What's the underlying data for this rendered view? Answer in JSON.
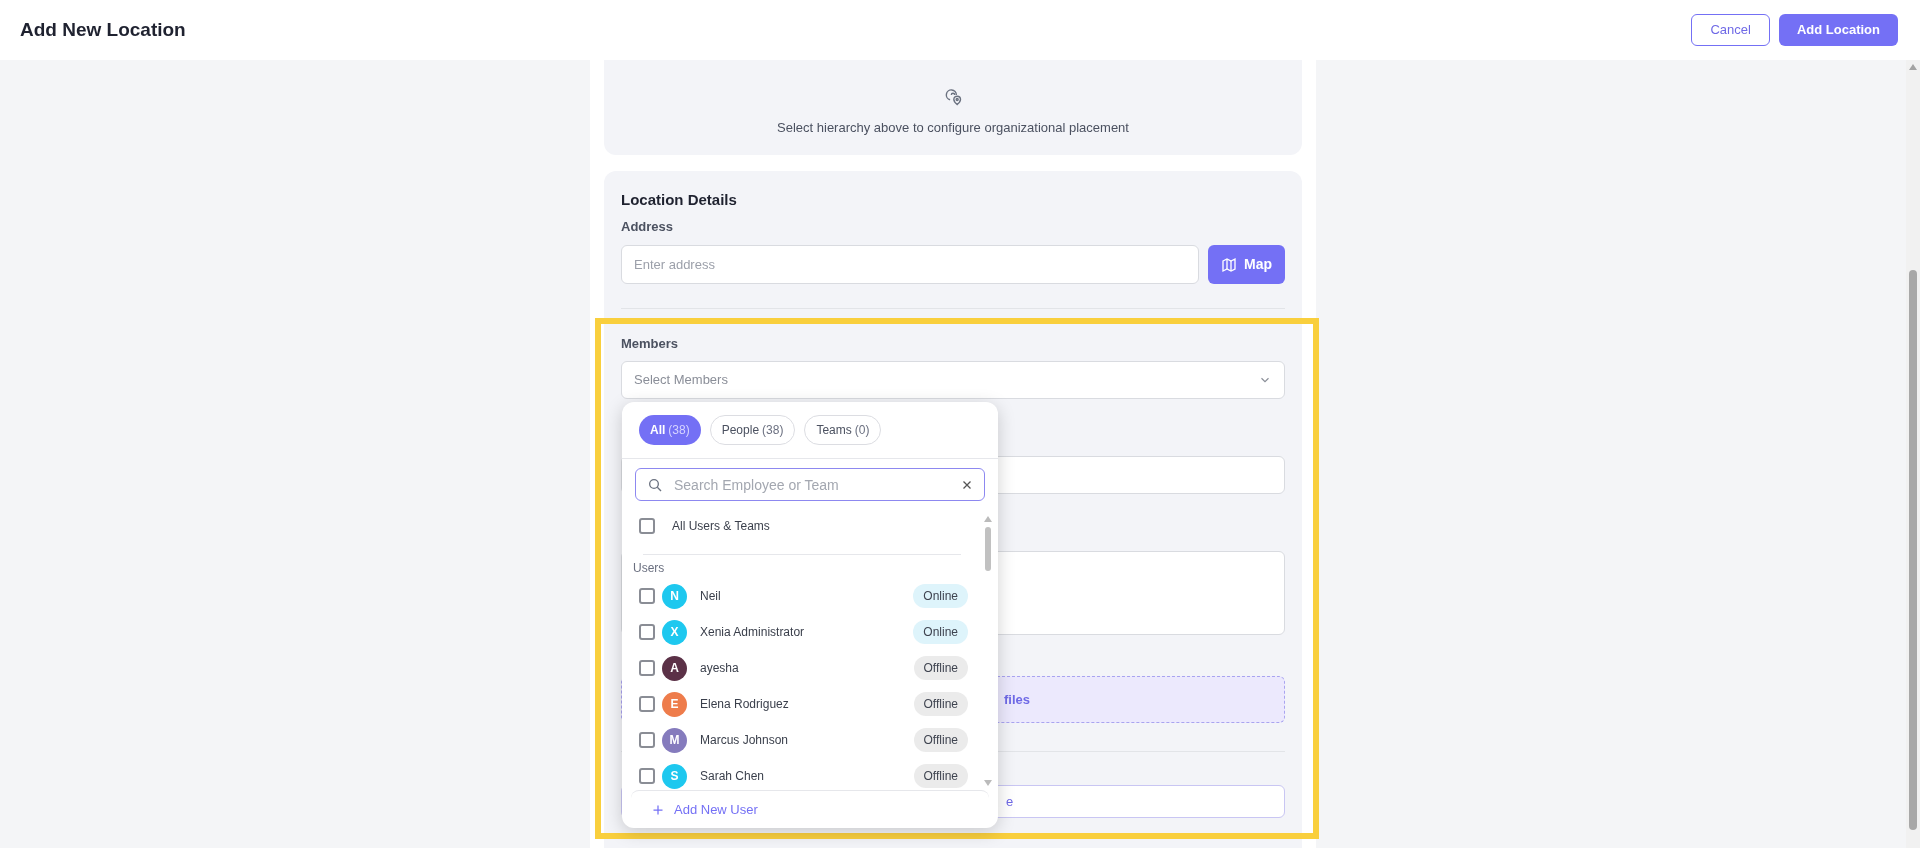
{
  "header": {
    "title": "Add New Location",
    "buttons": [
      {
        "label": "Cancel",
        "kind": "outline"
      },
      {
        "label": "Add Location",
        "kind": "primary"
      }
    ]
  },
  "placement_card": {
    "message": "Select hierarchy above to configure organizational placement"
  },
  "location_details": {
    "title": "Location Details",
    "address": {
      "label": "Address",
      "placeholder": "Enter address"
    },
    "map_button": "Map",
    "members": {
      "label": "Members",
      "placeholder": "Select Members"
    },
    "upload_text_fragment": "files",
    "field_text_fragment": "e"
  },
  "members_dropdown": {
    "tabs": [
      {
        "label": "All",
        "count": "(38)",
        "selected": true
      },
      {
        "label": "People",
        "count": "(38)",
        "selected": false
      },
      {
        "label": "Teams",
        "count": "(0)",
        "selected": false
      }
    ],
    "search": {
      "placeholder": "Search Employee or Team"
    },
    "select_all": {
      "label": "All Users & Teams",
      "checked": false
    },
    "section_label": "Users",
    "users": [
      {
        "initial": "N",
        "name": "Neil",
        "color": "#1ec8ef",
        "status": "Online",
        "online": true,
        "checked": false
      },
      {
        "initial": "X",
        "name": "Xenia Administrator",
        "color": "#1ec8ef",
        "status": "Online",
        "online": true,
        "checked": false
      },
      {
        "initial": "A",
        "name": "ayesha",
        "color": "#5b3147",
        "status": "Offline",
        "online": false,
        "checked": false
      },
      {
        "initial": "E",
        "name": "Elena Rodriguez",
        "color": "#ee7c4b",
        "status": "Offline",
        "online": false,
        "checked": false
      },
      {
        "initial": "M",
        "name": "Marcus Johnson",
        "color": "#857bbd",
        "status": "Offline",
        "online": false,
        "checked": false
      },
      {
        "initial": "S",
        "name": "Sarah Chen",
        "color": "#1ec8ef",
        "status": "Offline",
        "online": false,
        "checked": false
      }
    ],
    "footer_action": "Add New User"
  }
}
